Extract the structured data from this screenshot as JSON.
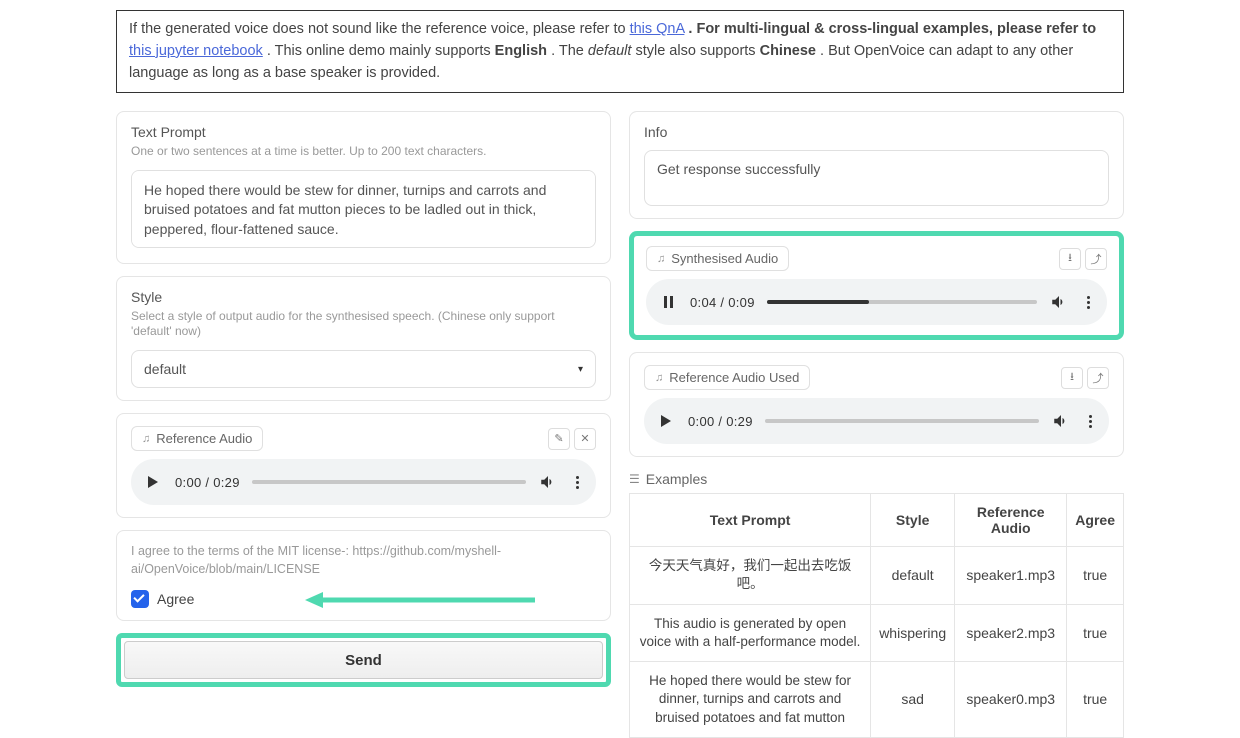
{
  "banner": {
    "part1": "If the generated voice does not sound like the reference voice, please refer to ",
    "link1": "this QnA",
    "part2": ". For multi-lingual & cross-lingual examples, please refer to ",
    "link2": "this jupyter notebook",
    "part3": ". This online demo mainly supports ",
    "bold1": "English",
    "part4": ". The ",
    "italic1": "default",
    "part5": " style also supports ",
    "bold2": "Chinese",
    "part6": ". But OpenVoice can adapt to any other language as long as a base speaker is provided."
  },
  "textPrompt": {
    "title": "Text Prompt",
    "sub": "One or two sentences at a time is better. Up to 200 text characters.",
    "value": "He hoped there would be stew for dinner, turnips and carrots and bruised potatoes and fat mutton pieces to be ladled out in thick, peppered, flour-fattened sauce."
  },
  "style": {
    "title": "Style",
    "sub": "Select a style of output audio for the synthesised speech. (Chinese only support 'default' now)",
    "value": "default"
  },
  "refAudio": {
    "label": "Reference Audio",
    "time": "0:00 / 0:29",
    "progress": 0
  },
  "license": {
    "text": "I agree to the terms of the MIT license-: https://github.com/myshell-ai/OpenVoice/blob/main/LICENSE",
    "agreeLabel": "Agree"
  },
  "sendLabel": "Send",
  "info": {
    "title": "Info",
    "value": "Get response successfully"
  },
  "synth": {
    "label": "Synthesised Audio",
    "time": "0:04 / 0:09",
    "progress": 38
  },
  "refUsed": {
    "label": "Reference Audio Used",
    "time": "0:00 / 0:29",
    "progress": 0
  },
  "examplesLabel": "Examples",
  "examples": {
    "headers": [
      "Text Prompt",
      "Style",
      "Reference Audio",
      "Agree"
    ],
    "rows": [
      {
        "prompt": "今天天气真好，我们一起出去吃饭吧。",
        "style": "default",
        "ref": "speaker1.mp3",
        "agree": "true"
      },
      {
        "prompt": "This audio is generated by open voice with a half-performance model.",
        "style": "whispering",
        "ref": "speaker2.mp3",
        "agree": "true"
      },
      {
        "prompt": "He hoped there would be stew for dinner, turnips and carrots and bruised potatoes and fat mutton",
        "style": "sad",
        "ref": "speaker0.mp3",
        "agree": "true"
      }
    ]
  }
}
